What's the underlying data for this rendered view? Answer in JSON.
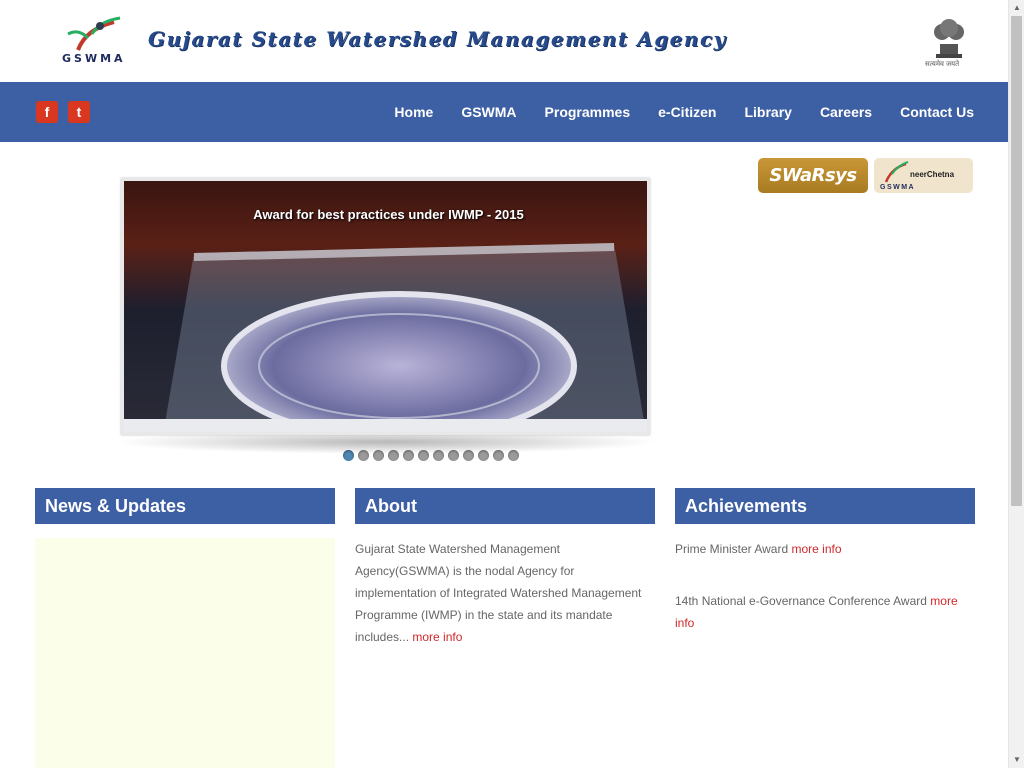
{
  "header": {
    "logo_text": "GSWMA",
    "title": "Gujarat State Watershed Management Agency",
    "emblem_text": "सत्यमेव जयते"
  },
  "social": {
    "facebook": "f",
    "twitter": "t"
  },
  "nav": {
    "items": [
      "Home",
      "GSWMA",
      "Programmes",
      "e-Citizen",
      "Library",
      "Careers",
      "Contact Us"
    ]
  },
  "side_logos": {
    "swarsys": "SWaRsys",
    "neerchetna": "neerChetna",
    "neerchetna_sub": "GSWMA"
  },
  "slider": {
    "caption": "Award for best practices under IWMP - 2015",
    "dot_count": 12,
    "active_index": 0
  },
  "sections": {
    "news": {
      "title": "News & Updates"
    },
    "about": {
      "title": "About",
      "text": "Gujarat State Watershed Management Agency(GSWMA) is the nodal Agency for implementation of Integrated Watershed Management Programme (IWMP) in the state and its mandate includes...",
      "more": "more info"
    },
    "achievements": {
      "title": "Achievements",
      "items": [
        {
          "text": "Prime Minister Award",
          "more": "more info"
        },
        {
          "text": "14th National e-Governance Conference Award",
          "more": "more info"
        }
      ]
    }
  },
  "colors": {
    "nav_bg": "#3d5fa4",
    "link_red": "#d0282a",
    "news_bg": "#fbfee8"
  }
}
